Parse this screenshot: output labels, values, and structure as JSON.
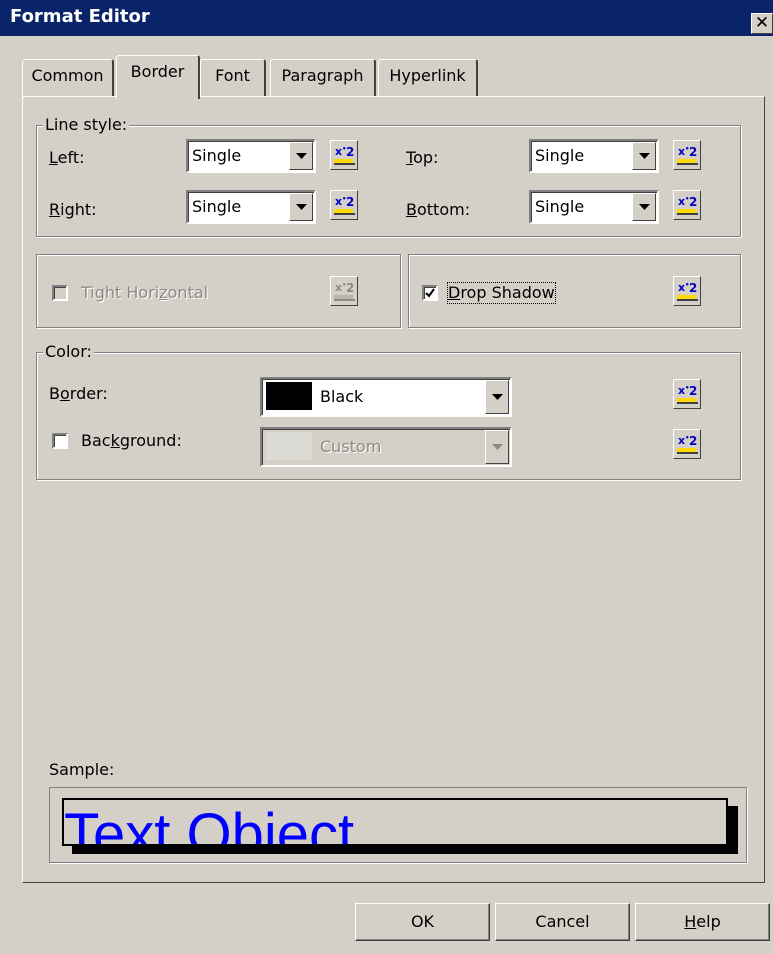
{
  "window": {
    "title": "Format Editor",
    "close_glyph": "✕"
  },
  "tabs": [
    {
      "label": "Common",
      "active": false
    },
    {
      "label": "Border",
      "active": true
    },
    {
      "label": "Font",
      "active": false
    },
    {
      "label": "Paragraph",
      "active": false
    },
    {
      "label": "Hyperlink",
      "active": false
    }
  ],
  "line_style": {
    "legend": "Line style:",
    "left": {
      "label_prefix": "",
      "label_mnemonic": "L",
      "label_rest": "eft:",
      "value": "Single"
    },
    "right": {
      "label_prefix": "",
      "label_mnemonic": "R",
      "label_rest": "ight:",
      "value": "Single"
    },
    "top": {
      "label_prefix": "",
      "label_mnemonic": "T",
      "label_rest": "op:",
      "value": "Single"
    },
    "bottom": {
      "label_prefix": "",
      "label_mnemonic": "B",
      "label_rest": "ottom:",
      "value": "Single"
    }
  },
  "tight_horizontal": {
    "label_prefix": "Tight Hori",
    "label_mnemonic": "z",
    "label_rest": "ontal",
    "checked": false,
    "enabled": false
  },
  "drop_shadow": {
    "label_prefix": "",
    "label_mnemonic": "D",
    "label_rest": "rop Shadow",
    "checked": true,
    "enabled": true
  },
  "color": {
    "legend": "Color:",
    "border": {
      "label_prefix": "B",
      "label_mnemonic": "o",
      "label_rest": "rder:",
      "value": "Black",
      "swatch": "#000000"
    },
    "background": {
      "label_prefix": "Bac",
      "label_mnemonic": "k",
      "label_rest": "ground:",
      "value": "Custom",
      "swatch": "#d4d0c8",
      "checked": false
    }
  },
  "sample": {
    "label": "Sample:",
    "text": "Text Object",
    "text_color": "#0000ff"
  },
  "buttons": {
    "ok": "OK",
    "cancel": "Cancel",
    "help_mnemonic": "H",
    "help_rest": "elp"
  },
  "icons": {
    "formula": "formula-x2-icon",
    "dropdown": "dropdown-arrow-icon",
    "check": "checkmark-icon"
  },
  "colors": {
    "face": "#d4d0c8",
    "titlebar": "#0a246a",
    "icon_blue": "#0000cc",
    "icon_yellow": "#ffd800"
  }
}
